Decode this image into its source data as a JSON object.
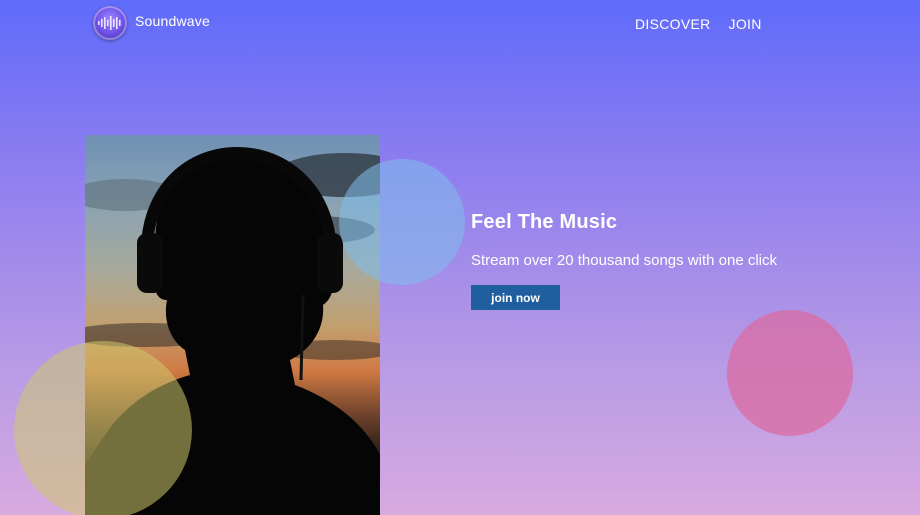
{
  "header": {
    "logo_icon": "soundwave-logo-icon",
    "brand_name": "Soundwave",
    "nav": [
      {
        "label": "DISCOVER"
      },
      {
        "label": "JOIN"
      }
    ]
  },
  "hero": {
    "image": "headphones-silhouette-sunset-photo",
    "title": "Feel The Music",
    "subtitle": "Stream over 20 thousand songs with one click",
    "cta_label": "join now"
  },
  "colors": {
    "cta_background": "#1f5fa0",
    "circle_blue": "#80beeb",
    "circle_pink": "#dc69a0",
    "circle_yellow": "#cdc86e",
    "gradient_top": "#5f6bfb",
    "gradient_bottom": "#d8aae0"
  }
}
